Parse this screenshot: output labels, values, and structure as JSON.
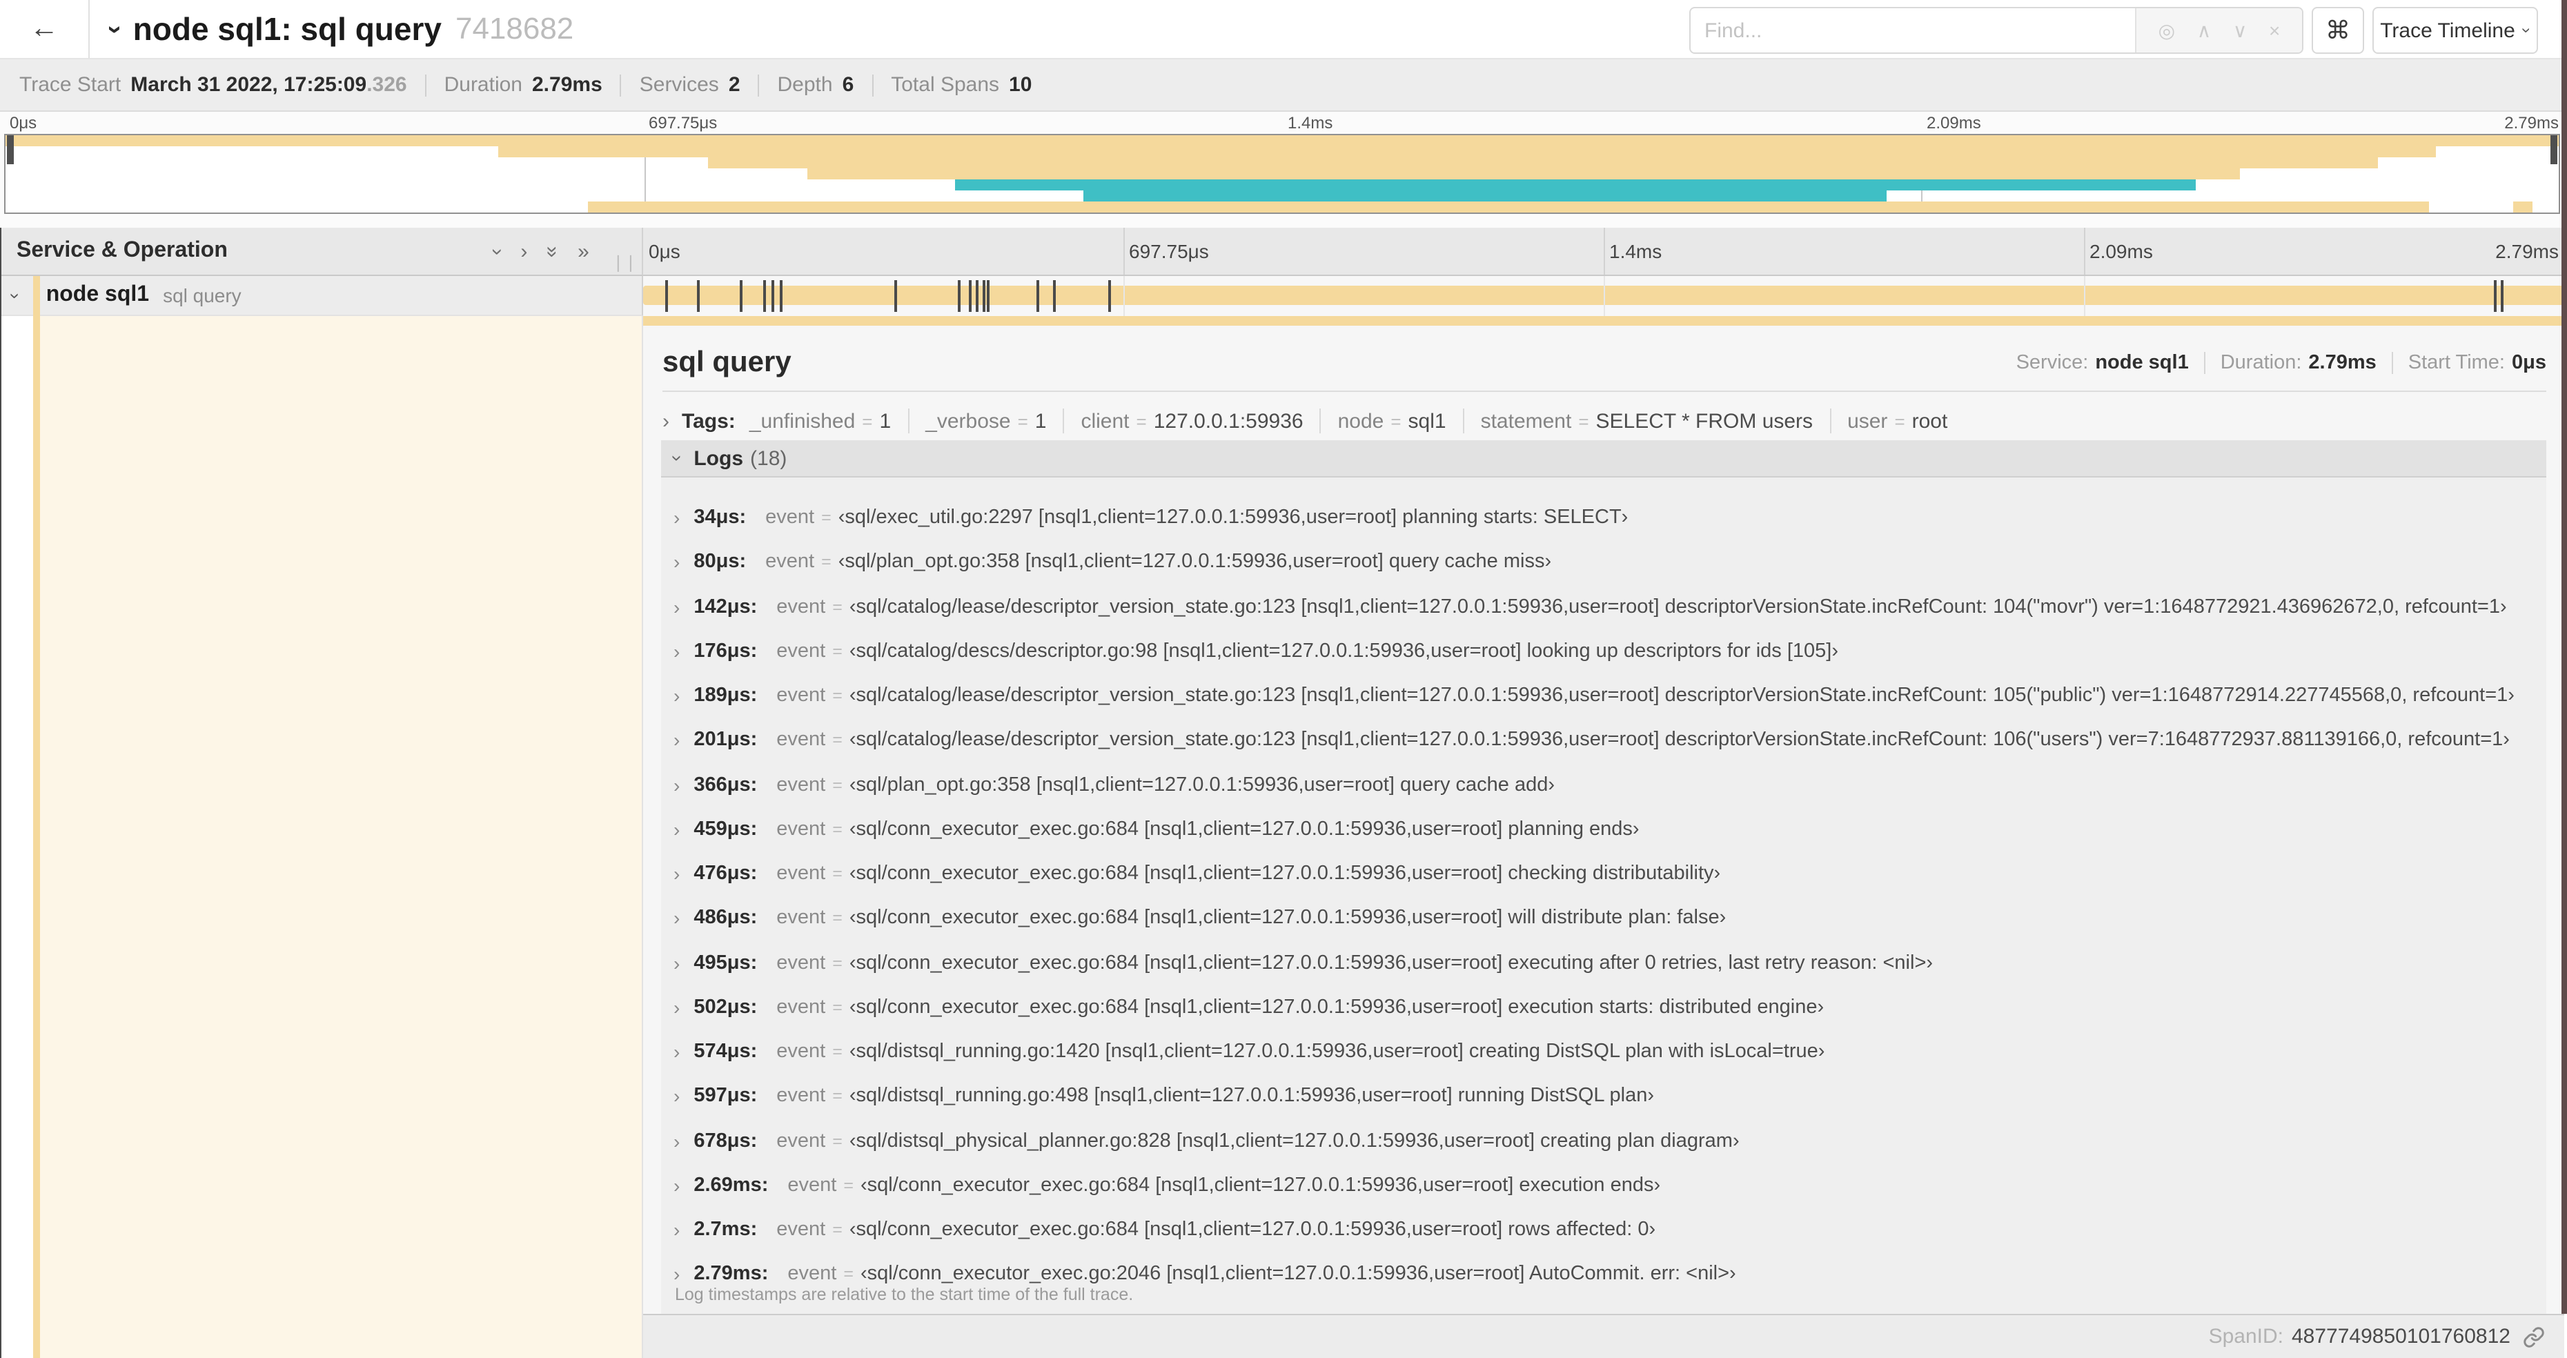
{
  "colors": {
    "tan": "#F5D99C",
    "teal": "#3FBFC5",
    "cream": "#FDF6E7",
    "marker": "#4a4a4a"
  },
  "header": {
    "back_icon": "←",
    "title": "node sql1: sql query",
    "trace_id_short": "7418682",
    "find_placeholder": "Find...",
    "find_icons": [
      "◎",
      "∧",
      "∨",
      "×"
    ],
    "shortcut_icon": "⌘",
    "view_selector_label": "Trace Timeline"
  },
  "summary": {
    "items": [
      {
        "label": "Trace Start",
        "value": "March 31 2022, 17:25:09",
        "suffix": ".326"
      },
      {
        "label": "Duration",
        "value": "2.79ms"
      },
      {
        "label": "Services",
        "value": "2"
      },
      {
        "label": "Depth",
        "value": "6"
      },
      {
        "label": "Total Spans",
        "value": "10"
      }
    ]
  },
  "minimap": {
    "ticks": [
      {
        "label": "0μs",
        "f": 0
      },
      {
        "label": "697.75μs",
        "f": 0.25
      },
      {
        "label": "1.4ms",
        "f": 0.5
      },
      {
        "label": "2.09ms",
        "f": 0.75
      },
      {
        "label": "2.79ms",
        "f": 1
      }
    ],
    "bars": [
      {
        "row": 0,
        "start": 0,
        "end": 1,
        "color": "tan"
      },
      {
        "row": 1,
        "start": 0.193,
        "end": 0.952,
        "color": "tan"
      },
      {
        "row": 2,
        "start": 0.275,
        "end": 0.929,
        "color": "tan"
      },
      {
        "row": 3,
        "start": 0.314,
        "end": 0.875,
        "color": "tan"
      },
      {
        "row": 4,
        "start": 0.372,
        "end": 0.858,
        "color": "teal"
      },
      {
        "row": 5,
        "start": 0.422,
        "end": 0.737,
        "color": "teal"
      },
      {
        "row": 6,
        "start": 0.228,
        "end": 0.949,
        "color": "tan"
      },
      {
        "row": 6,
        "start": 0.982,
        "end": 0.99,
        "color": "tan"
      }
    ]
  },
  "timeline": {
    "column_header": "Service & Operation",
    "collapse_icons": [
      "collapse-one",
      "expand-one",
      "collapse-all",
      "expand-all"
    ],
    "ticks": [
      {
        "label": "0μs",
        "f": 0
      },
      {
        "label": "697.75μs",
        "f": 0.25
      },
      {
        "label": "1.4ms",
        "f": 0.5
      },
      {
        "label": "2.09ms",
        "f": 0.75
      },
      {
        "label": "2.79ms",
        "f": 1
      }
    ],
    "row": {
      "service": "node sql1",
      "operation": "sql query"
    },
    "total_us": 2790,
    "log_marker_times_us": [
      34,
      80,
      142,
      176,
      189,
      201,
      366,
      459,
      476,
      486,
      495,
      502,
      574,
      597,
      678,
      2690,
      2700,
      2790
    ]
  },
  "detail": {
    "title": "sql query",
    "meta": {
      "service_label": "Service:",
      "service": "node sql1",
      "duration_label": "Duration:",
      "duration": "2.79ms",
      "start_label": "Start Time:",
      "start": "0μs"
    },
    "tags": {
      "label": "Tags:",
      "items": [
        {
          "key": "_unfinished",
          "value": "1"
        },
        {
          "key": "_verbose",
          "value": "1"
        },
        {
          "key": "client",
          "value": "127.0.0.1:59936"
        },
        {
          "key": "node",
          "value": "sql1"
        },
        {
          "key": "statement",
          "value": "SELECT * FROM users"
        },
        {
          "key": "user",
          "value": "root"
        }
      ]
    },
    "logs": {
      "label": "Logs",
      "count": "(18)",
      "field": "event",
      "entries": [
        {
          "time": "34μs:",
          "value": "‹sql/exec_util.go:2297 [nsql1,client=127.0.0.1:59936,user=root] planning starts: SELECT›"
        },
        {
          "time": "80μs:",
          "value": "‹sql/plan_opt.go:358 [nsql1,client=127.0.0.1:59936,user=root] query cache miss›"
        },
        {
          "time": "142μs:",
          "value": "‹sql/catalog/lease/descriptor_version_state.go:123 [nsql1,client=127.0.0.1:59936,user=root] descriptorVersionState.incRefCount: 104(\"movr\") ver=1:1648772921.436962672,0, refcount=1›"
        },
        {
          "time": "176μs:",
          "value": "‹sql/catalog/descs/descriptor.go:98 [nsql1,client=127.0.0.1:59936,user=root] looking up descriptors for ids [105]›"
        },
        {
          "time": "189μs:",
          "value": "‹sql/catalog/lease/descriptor_version_state.go:123 [nsql1,client=127.0.0.1:59936,user=root] descriptorVersionState.incRefCount: 105(\"public\") ver=1:1648772914.227745568,0, refcount=1›"
        },
        {
          "time": "201μs:",
          "value": "‹sql/catalog/lease/descriptor_version_state.go:123 [nsql1,client=127.0.0.1:59936,user=root] descriptorVersionState.incRefCount: 106(\"users\") ver=7:1648772937.881139166,0, refcount=1›"
        },
        {
          "time": "366μs:",
          "value": "‹sql/plan_opt.go:358 [nsql1,client=127.0.0.1:59936,user=root] query cache add›"
        },
        {
          "time": "459μs:",
          "value": "‹sql/conn_executor_exec.go:684 [nsql1,client=127.0.0.1:59936,user=root] planning ends›"
        },
        {
          "time": "476μs:",
          "value": "‹sql/conn_executor_exec.go:684 [nsql1,client=127.0.0.1:59936,user=root] checking distributability›"
        },
        {
          "time": "486μs:",
          "value": "‹sql/conn_executor_exec.go:684 [nsql1,client=127.0.0.1:59936,user=root] will distribute plan: false›"
        },
        {
          "time": "495μs:",
          "value": "‹sql/conn_executor_exec.go:684 [nsql1,client=127.0.0.1:59936,user=root] executing after 0 retries, last retry reason: <nil>›"
        },
        {
          "time": "502μs:",
          "value": "‹sql/conn_executor_exec.go:684 [nsql1,client=127.0.0.1:59936,user=root] execution starts: distributed engine›"
        },
        {
          "time": "574μs:",
          "value": "‹sql/distsql_running.go:1420 [nsql1,client=127.0.0.1:59936,user=root] creating DistSQL plan with isLocal=true›"
        },
        {
          "time": "597μs:",
          "value": "‹sql/distsql_running.go:498 [nsql1,client=127.0.0.1:59936,user=root] running DistSQL plan›"
        },
        {
          "time": "678μs:",
          "value": "‹sql/distsql_physical_planner.go:828 [nsql1,client=127.0.0.1:59936,user=root] creating plan diagram›"
        },
        {
          "time": "2.69ms:",
          "value": "‹sql/conn_executor_exec.go:684 [nsql1,client=127.0.0.1:59936,user=root] execution ends›"
        },
        {
          "time": "2.7ms:",
          "value": "‹sql/conn_executor_exec.go:684 [nsql1,client=127.0.0.1:59936,user=root] rows affected: 0›"
        },
        {
          "time": "2.79ms:",
          "value": "‹sql/conn_executor_exec.go:2046 [nsql1,client=127.0.0.1:59936,user=root] AutoCommit. err: <nil>›"
        }
      ],
      "footer_note": "Log timestamps are relative to the start time of the full trace."
    },
    "span_id_label": "SpanID:",
    "span_id": "4877749850101760812"
  }
}
